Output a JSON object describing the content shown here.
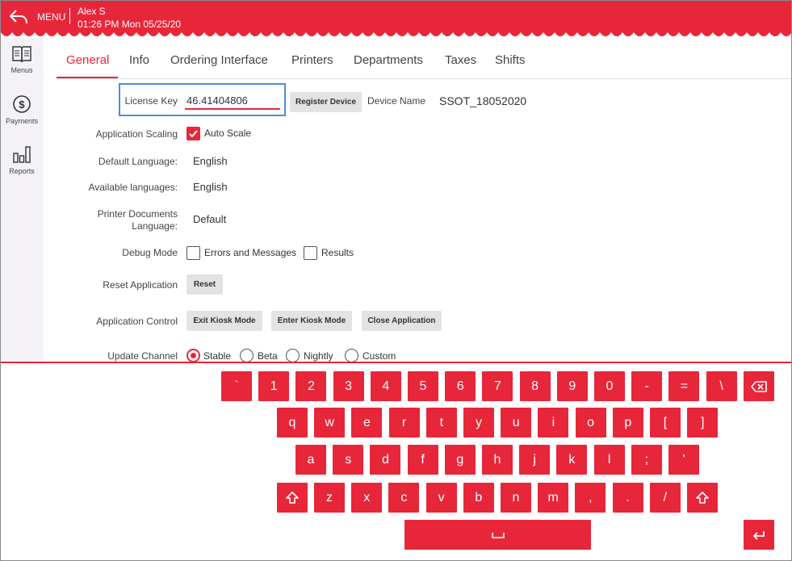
{
  "header": {
    "menu_label": "MENU",
    "user_name": "Alex S",
    "datetime": "01:26 PM Mon 05/25/20",
    "back_icon": "back-arrow-icon"
  },
  "sidebar": {
    "items": [
      {
        "label": "Menus",
        "icon": "book-icon"
      },
      {
        "label": "Payments",
        "icon": "dollar-icon"
      },
      {
        "label": "Reports",
        "icon": "bar-chart-icon"
      }
    ]
  },
  "tabs": [
    {
      "label": "General",
      "active": true
    },
    {
      "label": "Info"
    },
    {
      "label": "Ordering Interface"
    },
    {
      "label": "Printers"
    },
    {
      "label": "Departments"
    },
    {
      "label": "Taxes"
    },
    {
      "label": "Shifts"
    }
  ],
  "settings": {
    "license_key_label": "License Key",
    "license_key_value": "46.41404806",
    "register_button": "Register Device",
    "device_name_label": "Device Name",
    "device_name_value": "SSOT_18052020",
    "app_scaling_label": "Application Scaling",
    "auto_scale_label": "Auto Scale",
    "auto_scale_checked": true,
    "default_language_label": "Default Language:",
    "default_language_value": "English",
    "available_languages_label": "Available languages:",
    "available_languages_value": "English",
    "printer_docs_label_line1": "Printer Documents",
    "printer_docs_label_line2": "Language:",
    "printer_docs_value": "Default",
    "debug_mode_label": "Debug Mode",
    "debug_errors_label": "Errors and Messages",
    "debug_errors_checked": false,
    "debug_results_label": "Results",
    "debug_results_checked": false,
    "reset_app_label": "Reset Application",
    "reset_button": "Reset",
    "app_control_label": "Application Control",
    "exit_kiosk_button": "Exit Kiosk Mode",
    "enter_kiosk_button": "Enter Kiosk Mode",
    "close_app_button": "Close Application",
    "update_channel_label": "Update Channel",
    "update_channel_options": [
      "Stable",
      "Beta",
      "Nightly",
      "Custom"
    ],
    "update_channel_selected": "Stable"
  },
  "keyboard": {
    "row1": [
      "`",
      "1",
      "2",
      "3",
      "4",
      "5",
      "6",
      "7",
      "8",
      "9",
      "0",
      "-",
      "=",
      "\\"
    ],
    "row2": [
      "q",
      "w",
      "e",
      "r",
      "t",
      "y",
      "u",
      "i",
      "o",
      "p",
      "[",
      "]"
    ],
    "row3": [
      "a",
      "s",
      "d",
      "f",
      "g",
      "h",
      "j",
      "k",
      "l",
      ";",
      "'"
    ],
    "row4": [
      "z",
      "x",
      "c",
      "v",
      "b",
      "n",
      "m",
      ",",
      ".",
      "/"
    ],
    "backspace_icon": "backspace-icon",
    "shift_icon": "shift-icon",
    "space_icon": "space-icon",
    "enter_icon": "enter-icon"
  },
  "colors": {
    "accent": "#e8263a",
    "focus_outline": "#4a8fd6",
    "sidebar_bg": "#f4f2f7"
  }
}
